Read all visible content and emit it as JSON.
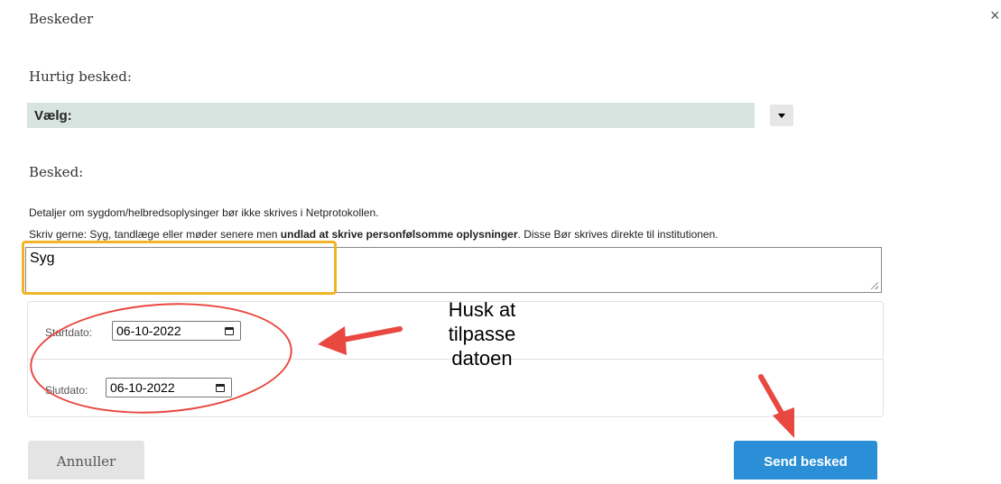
{
  "dialog": {
    "title": "Beskeder",
    "close_icon": "close-icon"
  },
  "quick_message": {
    "label": "Hurtig besked:",
    "selected": "Vælg:"
  },
  "message": {
    "label": "Besked:",
    "note_line1": "Detaljer om sygdom/helbredsoplysinger bør ikke skrives i Netprotokollen.",
    "note_line2_prefix": "Skriv gerne: Syg, tandlæge eller møder senere men ",
    "note_line2_bold": "undlad at skrive personfølsomme oplysninger",
    "note_line2_suffix": ". Disse Bør skrives direkte til institutionen.",
    "value": "Syg"
  },
  "dates": {
    "start_label": "Startdato:",
    "start_value": "06-10-2022",
    "end_label": "Slutdato:",
    "end_value": "06-10-2022"
  },
  "annotation": {
    "line1": "Husk at",
    "line2": "tilpasse",
    "line3": "datoen",
    "color": "#e8483f",
    "highlight_color": "#f0b429"
  },
  "actions": {
    "cancel_label": "Annuller",
    "send_label": "Send besked",
    "send_color": "#2a8fd6"
  }
}
